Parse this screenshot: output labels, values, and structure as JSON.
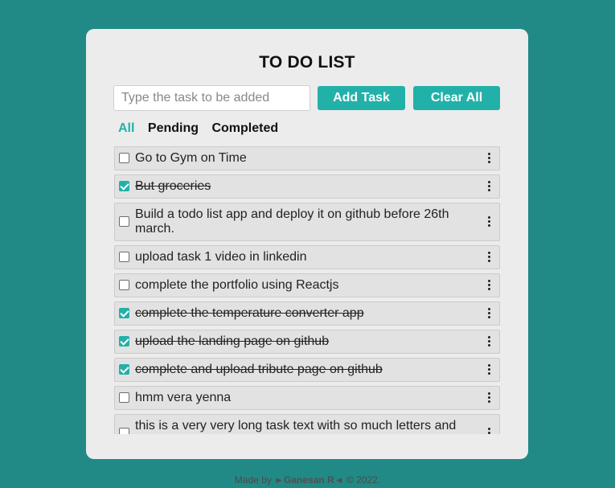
{
  "app": {
    "title": "TO DO LIST"
  },
  "input": {
    "placeholder": "Type the task to be added",
    "value": ""
  },
  "buttons": {
    "add_label": "Add Task",
    "clear_label": "Clear All"
  },
  "filters": [
    {
      "label": "All",
      "active": true
    },
    {
      "label": "Pending",
      "active": false
    },
    {
      "label": "Completed",
      "active": false
    }
  ],
  "tasks": [
    {
      "text": "Go to Gym on Time",
      "completed": false
    },
    {
      "text": "But groceries",
      "completed": true
    },
    {
      "text": "Build a todo list app and deploy it on github before 26th march.",
      "completed": false
    },
    {
      "text": "upload task 1 video in linkedin",
      "completed": false
    },
    {
      "text": "complete the portfolio using Reactjs",
      "completed": false
    },
    {
      "text": "complete the temperature converter app",
      "completed": true
    },
    {
      "text": "upload the landing page on github",
      "completed": true
    },
    {
      "text": "complete and upload tribute page on github",
      "completed": true
    },
    {
      "text": "hmm vera yenna",
      "completed": false
    },
    {
      "text": "this is a very very long task text with so much letters and",
      "completed": false
    }
  ],
  "footer": {
    "prefix": "Made by",
    "author": "►Ganesan R◄",
    "suffix": "© 2022."
  },
  "colors": {
    "background": "#218a86",
    "accent": "#22b1a9",
    "card": "#ececec"
  },
  "icons": {
    "task_menu": "more-vertical-icon",
    "checkbox": "checkbox-icon"
  }
}
